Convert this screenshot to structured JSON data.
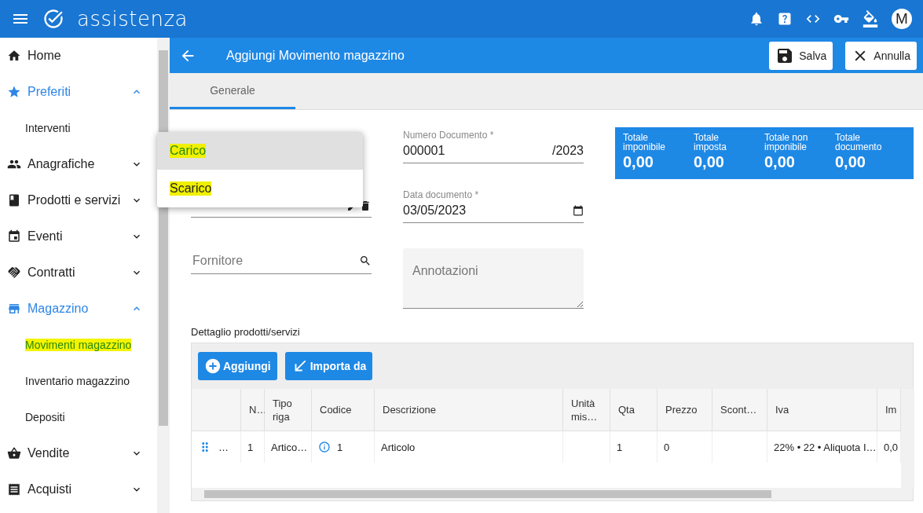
{
  "app": {
    "logo": "assistenza",
    "avatar": "M"
  },
  "sidebar": {
    "items": [
      {
        "label": "Home"
      },
      {
        "label": "Preferiti",
        "expanded": true,
        "children": [
          {
            "label": "Interventi",
            "highlighted": false
          }
        ]
      },
      {
        "label": "Anagrafiche",
        "expanded": false
      },
      {
        "label": "Prodotti e servizi",
        "expanded": false
      },
      {
        "label": "Eventi",
        "expanded": false
      },
      {
        "label": "Contratti",
        "expanded": false
      },
      {
        "label": "Magazzino",
        "expanded": true,
        "children": [
          {
            "label": "Movimenti magazzino",
            "highlighted": true
          },
          {
            "label": "Inventario magazzino",
            "highlighted": false
          },
          {
            "label": "Depositi",
            "highlighted": false
          }
        ]
      },
      {
        "label": "Vendite",
        "expanded": false
      },
      {
        "label": "Acquisti",
        "expanded": false
      }
    ]
  },
  "header": {
    "title": "Aggiungi Movimento magazzino",
    "buttons": [
      "Salva",
      "Annulla"
    ]
  },
  "tabs": [
    {
      "label": "Generale",
      "selected": true
    }
  ],
  "form": {
    "menu": [
      {
        "label": "Carico",
        "selected": true,
        "highlighted": true
      },
      {
        "label": "Scarico",
        "selected": false,
        "highlighted": true
      }
    ],
    "numero": {
      "label": "Numero Documento *",
      "value": "000001",
      "suffix": "/2023"
    },
    "data": {
      "label": "Data documento *",
      "value": "03/05/2023"
    },
    "fornitore": {
      "placeholder": "Fornitore"
    },
    "annotazioni": {
      "placeholder": "Annotazioni"
    }
  },
  "totals": [
    {
      "label": "Totale imponibile",
      "value": "0,00"
    },
    {
      "label": "Totale imposta",
      "value": "0,00"
    },
    {
      "label": "Totale non imponibile",
      "value": "0,00"
    },
    {
      "label": "Totale documento",
      "value": "0,00"
    }
  ],
  "detail": {
    "title": "Dettaglio prodotti/servizi",
    "buttons": [
      "Aggiungi",
      "Importa da"
    ],
    "columns": [
      "",
      "N…",
      "Tipo riga",
      "Codice",
      "Descrizione",
      "Unità mis…",
      "Qta",
      "Prezzo",
      "Scont…",
      "Iva",
      "Im"
    ],
    "rows": [
      [
        "…",
        "1",
        "Artico…",
        "1",
        "Articolo",
        "",
        "1",
        "0",
        "",
        "22% • 22 • Aliquota I…",
        "0,0"
      ]
    ]
  }
}
